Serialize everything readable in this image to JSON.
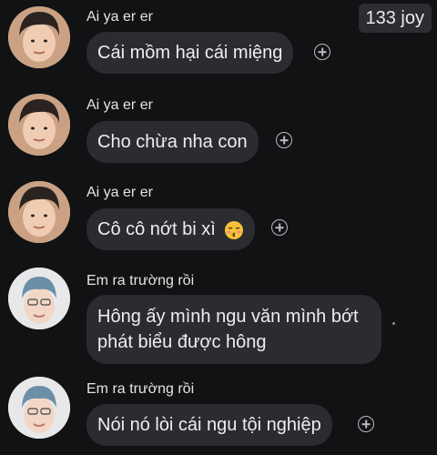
{
  "header": {
    "reaction_count": "133 joy"
  },
  "messages": [
    {
      "sender": "Ai ya er er",
      "text": "Cái mồm hại cái miệng",
      "avatar": "avatar-boy"
    },
    {
      "sender": "Ai ya er er",
      "text": "Cho chừa nha con",
      "avatar": "avatar-boy"
    },
    {
      "sender": "Ai ya er er",
      "text": "Cô cô nớt bi xì",
      "emoji": "kissing-face-emoji",
      "avatar": "avatar-boy"
    },
    {
      "sender": "Em ra trường rồi",
      "text_line1": "Hông ấy mình ngu văn mình bớt",
      "text_line2": "phát biểu được hông",
      "avatar": "avatar-man"
    },
    {
      "sender": "Em ra trường rồi",
      "text": "Nói nó lòi cái ngu tội nghiệp",
      "avatar": "avatar-man"
    }
  ],
  "colors": {
    "background": "#111214",
    "bubble": "#2b2c30",
    "text": "#eceef0"
  },
  "icons": [
    "add-reaction-icon",
    "kissing-face-emoji"
  ]
}
